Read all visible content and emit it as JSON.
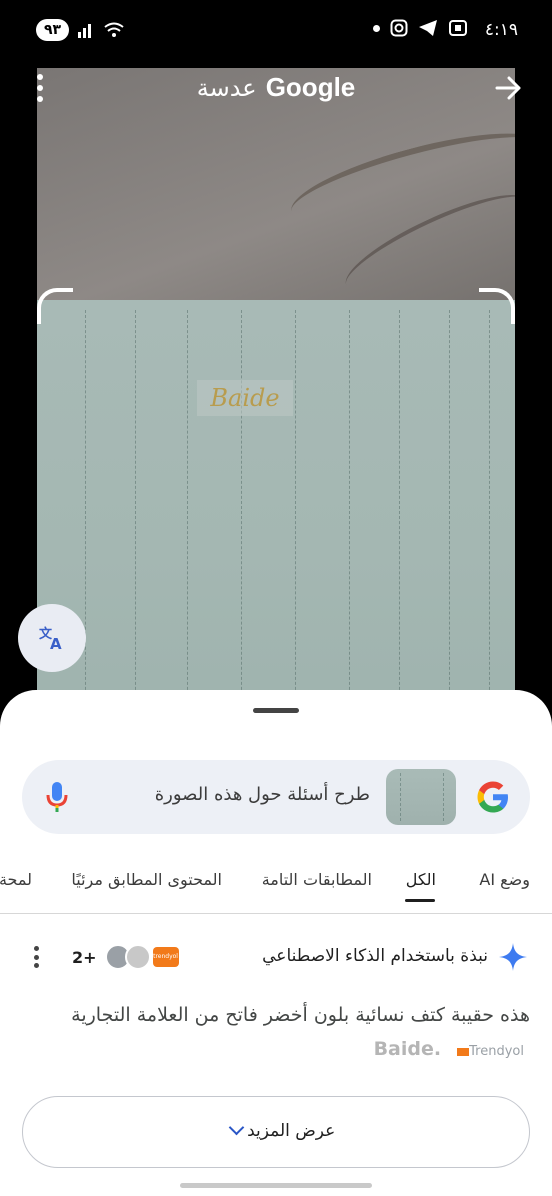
{
  "status_bar": {
    "time": "٤:١٩",
    "battery": "٩٣"
  },
  "header": {
    "brand": "Google",
    "product": "عدسة"
  },
  "image": {
    "brand_text": "Baide"
  },
  "search": {
    "placeholder": "طرح أسئلة حول هذه الصورة"
  },
  "tabs": [
    {
      "label": "وضع AI"
    },
    {
      "label": "الكل"
    },
    {
      "label": "المطابقات التامة"
    },
    {
      "label": "المحتوى المطابق مرئيًا"
    },
    {
      "label": "لمحة"
    }
  ],
  "ai_overview": {
    "title": "نبذة باستخدام الذكاء الاصطناعي",
    "source_count": "2+",
    "source_badge": "trendyol",
    "body": "هذه حقيبة كتف نسائية بلون أخضر فاتح من العلامة التجارية",
    "body_brand": "Baide.",
    "source_chip": "Trendyol"
  },
  "show_more": {
    "label": "عرض المزيد"
  },
  "colors": {
    "accent_blue": "#2a56c6",
    "sheet_bg": "#ffffff",
    "search_bg": "#edf0f6"
  }
}
